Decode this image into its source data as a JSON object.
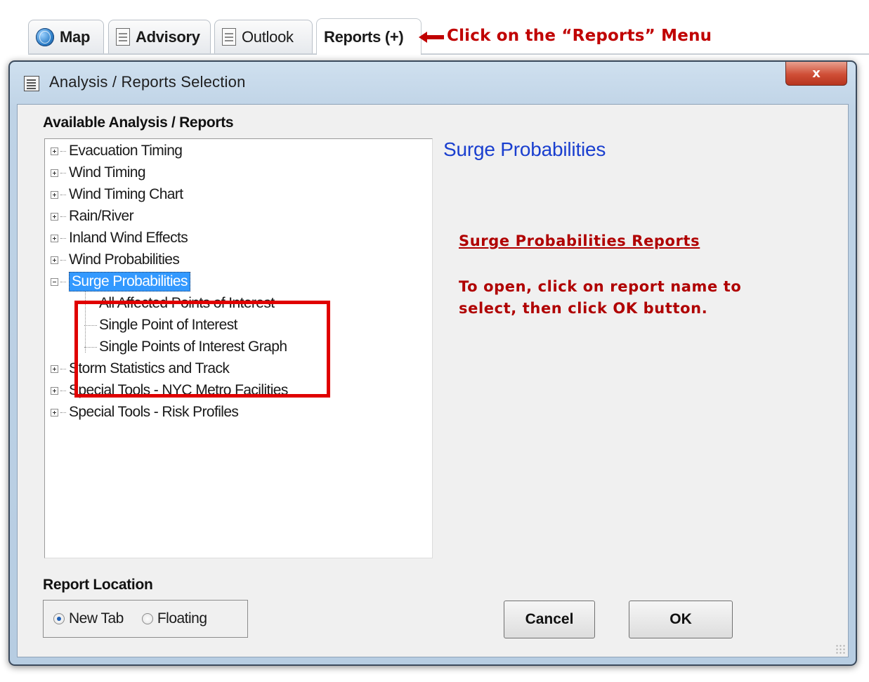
{
  "tabs": [
    {
      "label": "Map",
      "icon": "globe-icon"
    },
    {
      "label": "Advisory",
      "icon": "document-icon"
    },
    {
      "label": "Outlook",
      "icon": "document-icon"
    },
    {
      "label": "Reports (+)",
      "active": true
    }
  ],
  "callout": {
    "text": "Click on the “Reports” Menu",
    "color": "#c00000"
  },
  "window": {
    "title": "Analysis / Reports Selection",
    "close_label": "x"
  },
  "reports_panel": {
    "heading": "Available Analysis / Reports",
    "items": [
      {
        "label": "Evacuation Timing",
        "expanded": false
      },
      {
        "label": "Wind Timing",
        "expanded": false
      },
      {
        "label": "Wind Timing Chart",
        "expanded": false
      },
      {
        "label": "Rain/River",
        "expanded": false
      },
      {
        "label": "Inland Wind Effects",
        "expanded": false
      },
      {
        "label": "Wind Probabilities",
        "expanded": false
      },
      {
        "label": "Surge Probabilities",
        "expanded": true,
        "selected": true,
        "children": [
          "All Affected Points of Interest",
          "Single Point of Interest",
          "Single Points of Interest Graph"
        ]
      },
      {
        "label": "Storm Statistics and Track",
        "expanded": false
      },
      {
        "label": "Special Tools - NYC Metro Facilities",
        "expanded": false
      },
      {
        "label": "Special Tools - Risk Profiles",
        "expanded": false
      }
    ]
  },
  "detail": {
    "title": "Surge Probabilities",
    "instruction_heading": "Surge Probabilities Reports",
    "instruction_line1": "To open, click on report name to",
    "instruction_line2": "select, then click OK button."
  },
  "report_location": {
    "heading": "Report Location",
    "options": [
      "New Tab",
      "Floating"
    ],
    "selected": "New Tab"
  },
  "buttons": {
    "cancel": "Cancel",
    "ok": "OK"
  },
  "colors": {
    "callout": "#c00000",
    "selection": "#3399ff",
    "detail_title": "#1a3fcf",
    "instructions": "#b00000",
    "highlight_box": "#e00000"
  }
}
